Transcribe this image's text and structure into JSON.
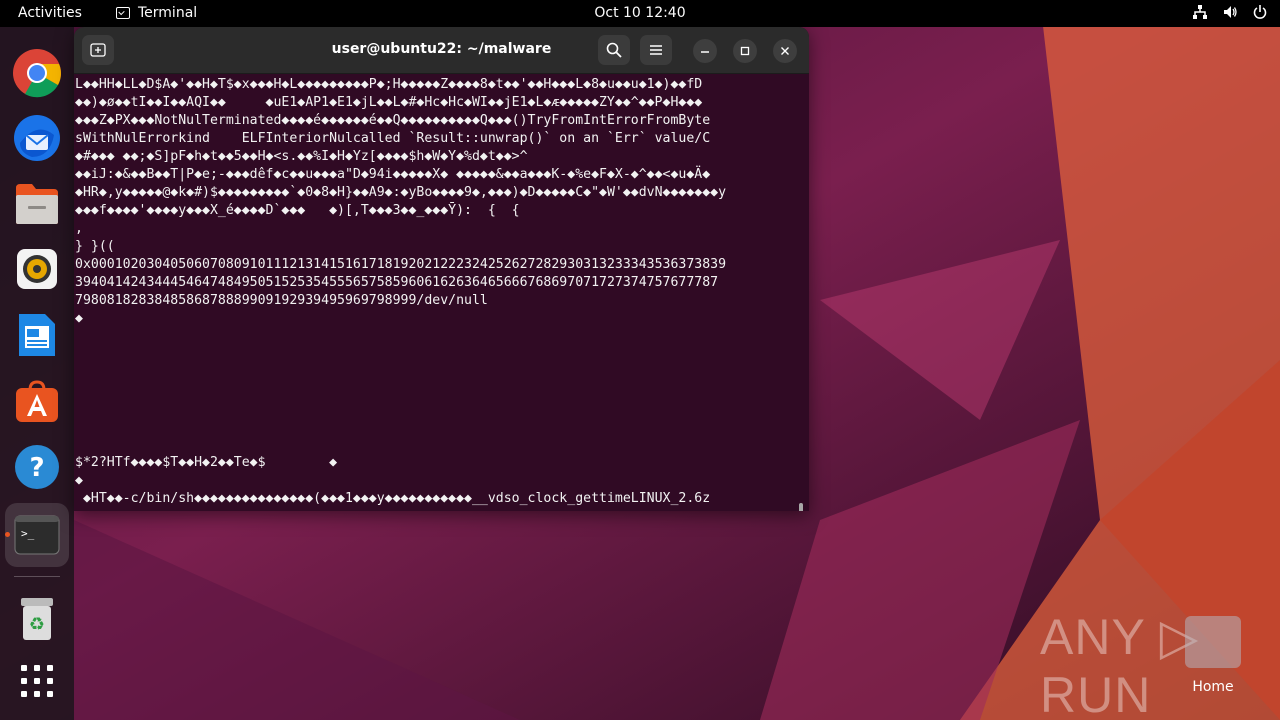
{
  "topbar": {
    "activities": "Activities",
    "app_name": "Terminal",
    "clock": "Oct 10  12:40",
    "icons": [
      "network-icon",
      "volume-icon",
      "power-icon"
    ]
  },
  "dock": {
    "items": [
      {
        "name": "chrome",
        "icon": "chrome-icon"
      },
      {
        "name": "thunderbird",
        "icon": "thunderbird-icon"
      },
      {
        "name": "files",
        "icon": "files-icon"
      },
      {
        "name": "rhythmbox",
        "icon": "rhythmbox-icon"
      },
      {
        "name": "writer",
        "icon": "writer-icon"
      },
      {
        "name": "software",
        "icon": "software-icon"
      },
      {
        "name": "help",
        "icon": "help-icon"
      },
      {
        "name": "terminal",
        "icon": "terminal-icon",
        "active": true
      },
      {
        "name": "trash",
        "icon": "trash-icon"
      },
      {
        "name": "apps",
        "icon": "app-grid-icon"
      }
    ],
    "terminal_label": ">_"
  },
  "terminal": {
    "title": "user@ubuntu22: ~/malware",
    "lines": [
      "L◆◆HH◆LL◆D$A◆'◆◆H◆T$◆x◆◆◆H◆L◆◆◆◆◆◆◆◆◆P◆;H◆◆◆◆◆Z◆◆◆◆8◆t◆◆'◆◆H◆◆◆L◆8◆u◆◆u◆1◆)◆◆fD",
      "◆◆)◆ø◆◆tI◆◆I◆◆AQI◆◆     ◆uE1◆AP1◆E1◆jL◆◆L◆#◆Hc◆Hc◆WI◆◆jE1◆L◆ᴁ◆◆◆◆◆ZY◆◆^◆◆P◆H◆◆◆",
      "◆◆◆Z◆PX◆◆◆NotNulTerminated◆◆◆◆é◆◆◆◆◆◆é◆◆Q◆◆◆◆◆◆◆◆◆◆Q◆◆◆()TryFromIntErrorFromByte",
      "sWithNulErrorkind    ELFInteriorNulcalled `Result::unwrap()` on an `Err` value/C",
      "◆#◆◆◆ ◆◆;◆S]pF◆h◆t◆◆5◆◆H◆<s.◆◆%I◆H◆Yz[◆◆◆◆$h◆W◆Y◆%d◆t◆◆>^",
      "◆◆iJ:◆&◆◆B◆◆T|P◆e;-◆◆◆dêf◆c◆◆u◆◆◆a\"D◆94i◆◆◆◆◆X◆ ◆◆◆◆◆&◆◆a◆◆◆K-◆%e◆F◆X-◆^◆◆<◆u◆Ä◆",
      "◆HR◆,y◆◆◆◆◆@◆k◆#)$◆◆◆◆◆◆◆◆◆`◆0◆8◆H}◆◆A9◆:◆yBo◆◆◆◆9◆,◆◆◆)◆D◆◆◆◆◆C◆\"◆W'◆◆dvN◆◆◆◆◆◆◆y",
      "◆◆◆f◆◆◆◆'◆◆◆◆y◆◆◆X_é◆◆◆◆D`◆◆◆   ◆)[,T◆◆◆3◆◆_◆◆◆Ȳ):  {  {",
      ",",
      "} }((",
      "0x00010203040506070809101112131415161718192021222324252627282930313233343536373839",
      "394041424344454647484950515253545556575859606162636465666768697071727374757677787",
      "7980818283848586878889909192939495969798999/dev/null",
      "◆",
      "$*2?HTf◆◆◆◆$T◆◆H◆2◆◆Te◆$        ◆",
      "◆",
      " ◆HT◆◆-c/bin/sh◆◆◆◆◆◆◆◆◆◆◆◆◆◆◆(◆◆◆1◆◆◆y◆◆◆◆◆◆◆◆◆◆◆__vdso_clock_gettimeLINUX_2.6z"
    ]
  },
  "desktop": {
    "watermark": "ANY ▷ RUN",
    "home_label": "Home"
  }
}
